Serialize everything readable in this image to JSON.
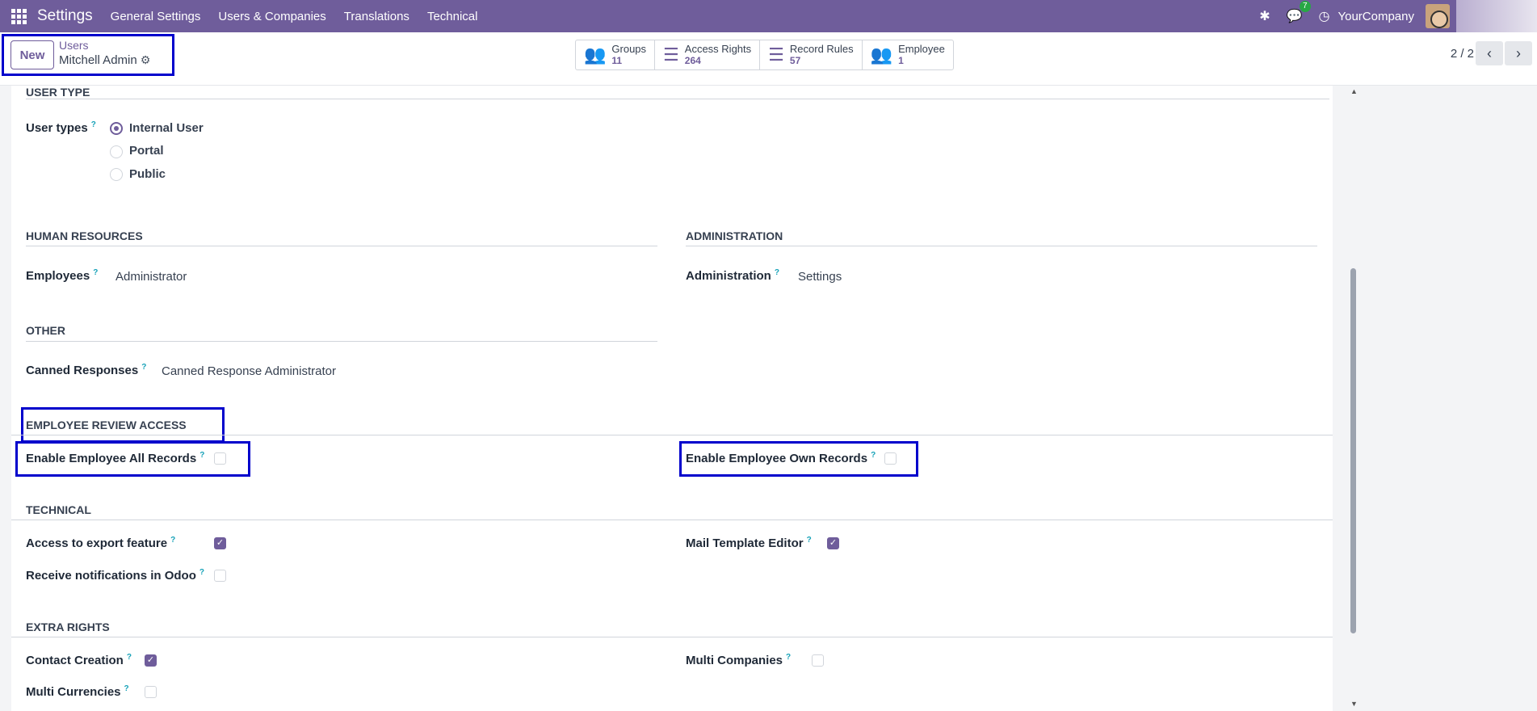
{
  "navbar": {
    "brand": "Settings",
    "menu": [
      "General Settings",
      "Users & Companies",
      "Translations",
      "Technical"
    ],
    "message_count": "7",
    "company": "YourCompany"
  },
  "control_panel": {
    "new_label": "New",
    "breadcrumb_parent": "Users",
    "breadcrumb_current": "Mitchell Admin",
    "stats": [
      {
        "label": "Groups",
        "value": "11",
        "icon": "users-icon"
      },
      {
        "label": "Access Rights",
        "value": "264",
        "icon": "list-icon"
      },
      {
        "label": "Record Rules",
        "value": "57",
        "icon": "list-icon"
      },
      {
        "label": "Employee",
        "value": "1",
        "icon": "users-icon"
      }
    ],
    "pager": "2 / 2"
  },
  "form": {
    "user_type": {
      "title": "USER TYPE",
      "label": "User types",
      "options": [
        "Internal User",
        "Portal",
        "Public"
      ],
      "selected": "Internal User"
    },
    "human_resources": {
      "title": "HUMAN RESOURCES",
      "label": "Employees",
      "value": "Administrator"
    },
    "administration": {
      "title": "ADMINISTRATION",
      "label": "Administration",
      "value": "Settings"
    },
    "other": {
      "title": "OTHER",
      "label": "Canned Responses",
      "value": "Canned Response Administrator"
    },
    "employee_review": {
      "title": "EMPLOYEE REVIEW ACCESS",
      "all_records": "Enable Employee All Records",
      "own_records": "Enable Employee Own Records"
    },
    "technical": {
      "title": "TECHNICAL",
      "export": "Access to export feature",
      "notifications": "Receive notifications in Odoo",
      "mail_template": "Mail Template Editor"
    },
    "extra_rights": {
      "title": "EXTRA RIGHTS",
      "contact_creation": "Contact Creation",
      "multi_currencies": "Multi Currencies",
      "multi_companies": "Multi Companies"
    }
  },
  "colors": {
    "brand": "#6f5d9b",
    "highlight": "#0000cc",
    "help": "#17a2b8"
  }
}
